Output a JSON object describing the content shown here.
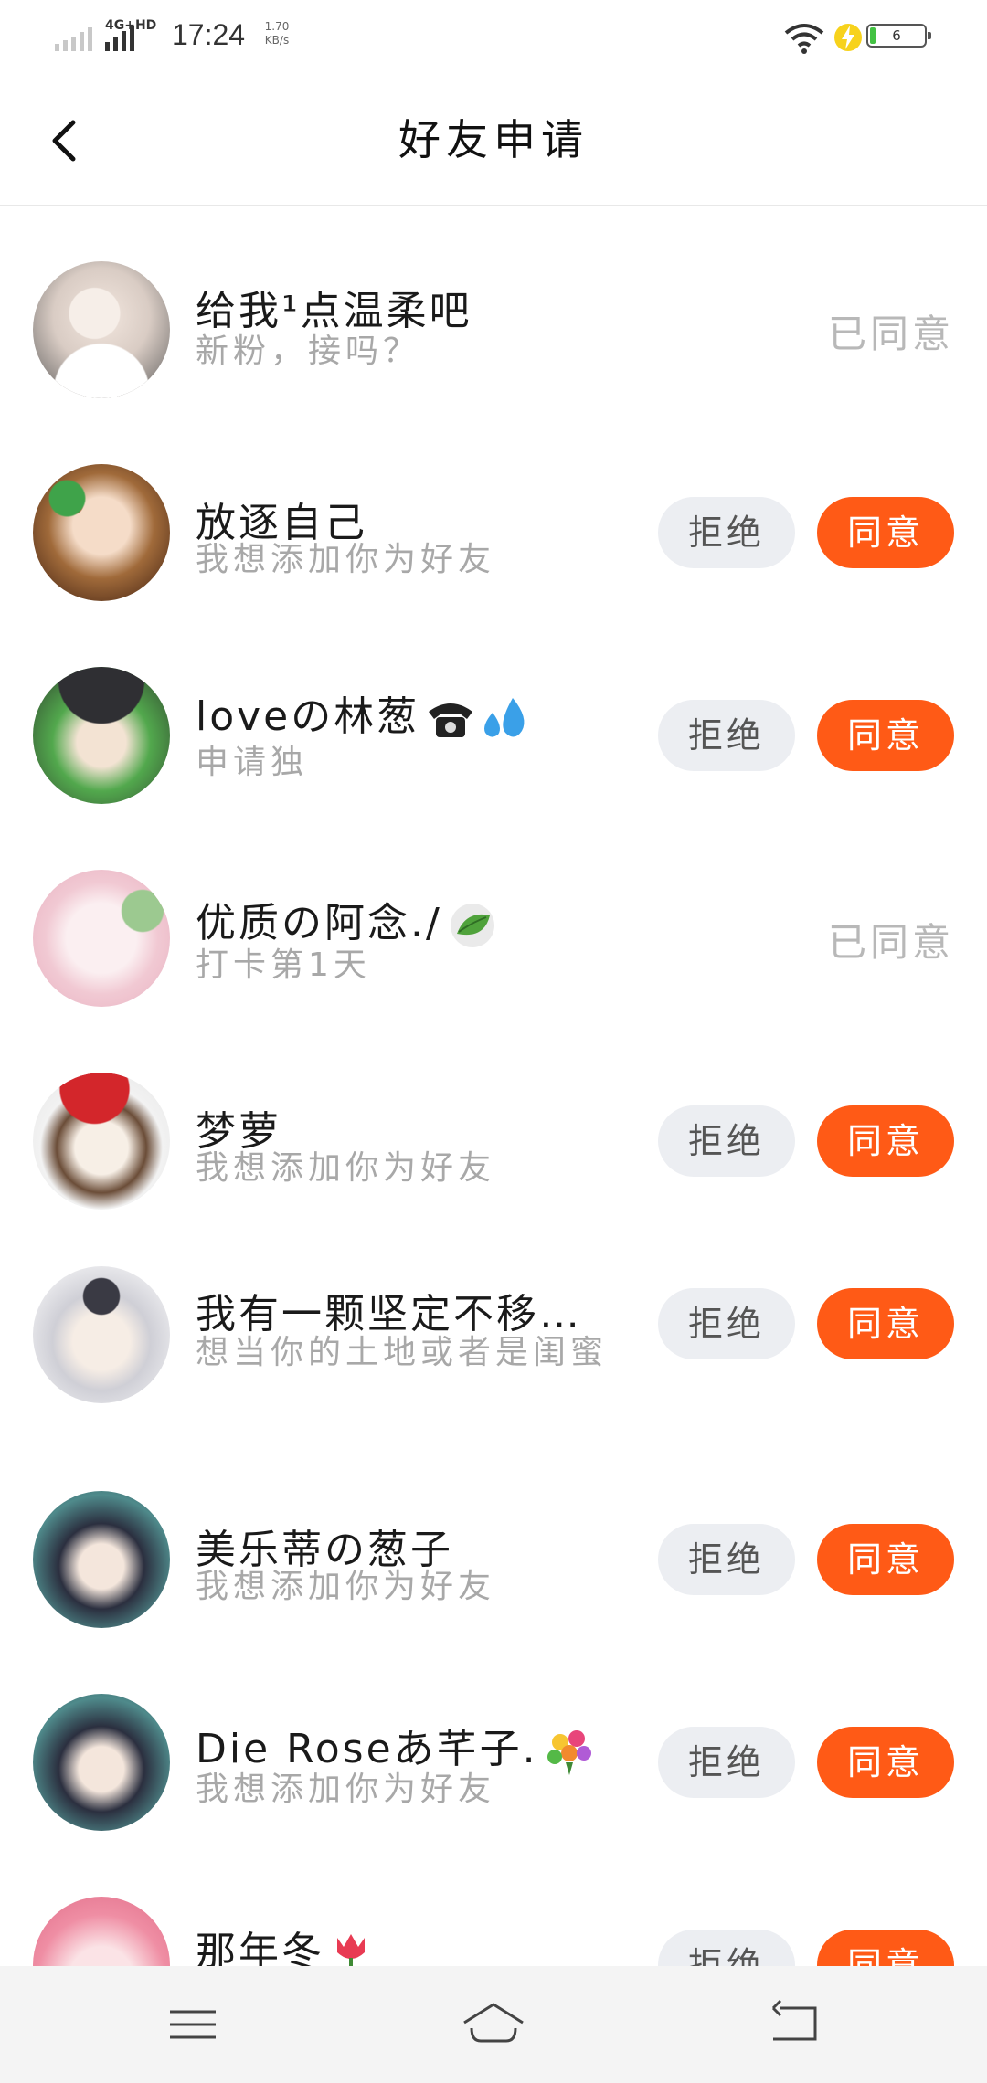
{
  "status_bar": {
    "network": "4G+HD",
    "time": "17:24",
    "speed_value": "1.70",
    "speed_unit": "KB/s",
    "battery": "6"
  },
  "header": {
    "title": "好友申请"
  },
  "requests": [
    {
      "name": "给我¹点温柔吧",
      "message": "新粉，接吗？",
      "status": "已同意"
    },
    {
      "name": "放逐自己",
      "message": "我想添加你为好友",
      "reject": "拒绝",
      "accept": "同意"
    },
    {
      "name": "loveの林葱",
      "message": "申请独",
      "reject": "拒绝",
      "accept": "同意"
    },
    {
      "name": "优质の阿念./",
      "message": "打卡第1天",
      "status": "已同意"
    },
    {
      "name": "梦萝",
      "message": "我想添加你为好友",
      "reject": "拒绝",
      "accept": "同意"
    },
    {
      "name": "我有一颗坚定不移…",
      "message": "想当你的土地或者是闺蜜",
      "reject": "拒绝",
      "accept": "同意"
    },
    {
      "name": "美乐蒂の葱子",
      "message": "我想添加你为好友",
      "reject": "拒绝",
      "accept": "同意"
    },
    {
      "name": "Die Roseあ芊子.",
      "message": "我想添加你为好友",
      "reject": "拒绝",
      "accept": "同意"
    },
    {
      "name": "那年冬",
      "message": "",
      "reject": "拒绝",
      "accept": "同意"
    }
  ],
  "colors": {
    "accent": "#ff5a16",
    "reject_bg": "#eceef2",
    "status_text": "#b8b8b8",
    "message_text": "#a8a8a8"
  },
  "icons": {
    "back": "chevron-left-icon",
    "nav_menu": "menu-icon",
    "nav_home": "home-icon",
    "nav_back": "back-icon"
  }
}
